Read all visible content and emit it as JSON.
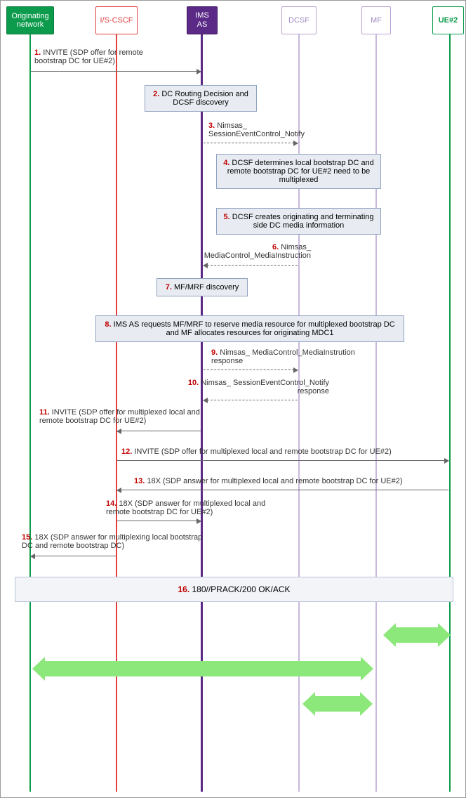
{
  "participants": {
    "originating": "Originating network",
    "iscscf": "I/S-CSCF",
    "imsas": "IMS AS",
    "dcsf": "DCSF",
    "mf": "MF",
    "ue2": "UE#2"
  },
  "steps": {
    "s1": "1.",
    "s1t": " INVITE (SDP offer for remote bootstrap DC for UE#2)",
    "s2": "2.",
    "s2t": " DC Routing Decision and DCSF discovery",
    "s3": "3.",
    "s3t": " Nimsas_ SessionEventControl_Notify",
    "s4": "4.",
    "s4t": " DCSF determines local bootstrap DC and remote bootstrap DC for UE#2 need to be  multiplexed",
    "s5": "5.",
    "s5t": " DCSF creates originating and terminating side DC media information",
    "s6": "6.",
    "s6t": " Nimsas_ MediaControl_MediaInstruction",
    "s7": "7.",
    "s7t": " MF/MRF discovery",
    "s8": "8.",
    "s8t": " IMS AS requests MF/MRF to reserve media resource for multiplexed bootstrap DC and MF allocates resources for originating MDC1",
    "s9": "9.",
    "s9t": " Nimsas_ MediaControl_MediaInstrution response",
    "s10": "10.",
    "s10t": " Nimsas_ SessionEventControl_Notify response",
    "s11": "11.",
    "s11t": " INVITE (SDP offer for multiplexed local and remote bootstrap DC for UE#2)",
    "s12": "12.",
    "s12t": " INVITE (SDP offer for multiplexed local and remote bootstrap DC for UE#2)",
    "s13": "13.",
    "s13t": " 18X (SDP answer for multiplexed local and remote bootstrap DC for UE#2)",
    "s14": "14.",
    "s14t": " 18X (SDP answer for multiplexed local and remote bootstrap DC for UE#2)",
    "s15": "15.",
    "s15t": " 18X (SDP answer for multiplexing local bootstrap DC and remote bootstrap DC)",
    "s16": "16.",
    "s16t": " 180//PRACK/200 OK/ACK"
  },
  "x": {
    "originating": 42,
    "iscscf": 165,
    "imsas": 287,
    "dcsf": 425,
    "mf": 535,
    "ue2": 640
  }
}
